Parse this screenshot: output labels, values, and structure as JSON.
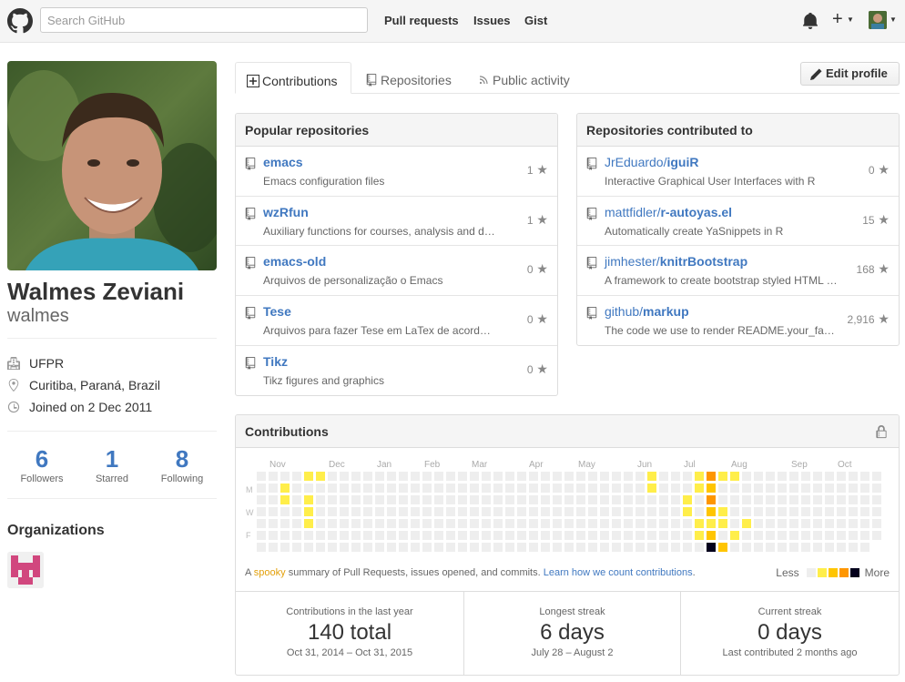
{
  "header": {
    "search_placeholder": "Search GitHub",
    "nav": [
      "Pull requests",
      "Issues",
      "Gist"
    ],
    "plus_glyph": "+"
  },
  "profile": {
    "name": "Walmes Zeviani",
    "login": "walmes",
    "organization": "UFPR",
    "location": "Curitiba, Paraná, Brazil",
    "joined": "Joined on 2 Dec 2011",
    "stats": [
      {
        "value": "6",
        "label": "Followers"
      },
      {
        "value": "1",
        "label": "Starred"
      },
      {
        "value": "8",
        "label": "Following"
      }
    ],
    "organizations_heading": "Organizations"
  },
  "tabs": [
    {
      "label": "Contributions",
      "icon": "plus-square-icon",
      "selected": true
    },
    {
      "label": "Repositories",
      "icon": "repo-icon",
      "selected": false
    },
    {
      "label": "Public activity",
      "icon": "rss-icon",
      "selected": false
    }
  ],
  "edit_profile_label": "Edit profile",
  "popular_repos": {
    "title": "Popular repositories",
    "items": [
      {
        "name": "emacs",
        "desc": "Emacs configuration files",
        "stars": "1"
      },
      {
        "name": "wzRfun",
        "desc": "Auxiliary functions for courses, analysis and d…",
        "stars": "1"
      },
      {
        "name": "emacs-old",
        "desc": "Arquivos de personalização o Emacs",
        "stars": "0"
      },
      {
        "name": "Tese",
        "desc": "Arquivos para fazer Tese em LaTex de acord…",
        "stars": "0"
      },
      {
        "name": "Tikz",
        "desc": "Tikz figures and graphics",
        "stars": "0"
      }
    ]
  },
  "contributed_repos": {
    "title": "Repositories contributed to",
    "items": [
      {
        "owner": "JrEduardo/",
        "name": "iguiR",
        "desc": "Interactive Graphical User Interfaces with R",
        "stars": "0"
      },
      {
        "owner": "mattfidler/",
        "name": "r-autoyas.el",
        "desc": "Automatically create YaSnippets in R",
        "stars": "15"
      },
      {
        "owner": "jimhester/",
        "name": "knitrBootstrap",
        "desc": "A framework to create bootstrap styled HTML …",
        "stars": "168"
      },
      {
        "owner": "github/",
        "name": "markup",
        "desc": "The code we use to render README.your_fa…",
        "stars": "2,916"
      }
    ]
  },
  "contributions": {
    "title": "Contributions",
    "months": [
      "Nov",
      "Dec",
      "Jan",
      "Feb",
      "Mar",
      "Apr",
      "May",
      "Jun",
      "Jul",
      "Aug",
      "Sep",
      "Oct"
    ],
    "day_labels": [
      "M",
      "W",
      "F"
    ],
    "note_prefix": "A ",
    "note_word": "spooky",
    "note_middle": " summary of Pull Requests, issues opened, and commits. ",
    "note_link": "Learn how we count contributions",
    "note_suffix": ".",
    "legend_less": "Less",
    "legend_more": "More",
    "legend_colors": [
      "#eeeeee",
      "#ffee4a",
      "#ffc501",
      "#fe9600",
      "#03001c"
    ],
    "stats": [
      {
        "title": "Contributions in the last year",
        "big": "140 total",
        "sub": "Oct 31, 2014 – Oct 31, 2015"
      },
      {
        "title": "Longest streak",
        "big": "6 days",
        "sub": "July 28 – August 2"
      },
      {
        "title": "Current streak",
        "big": "0 days",
        "sub": "Last contributed 2 months ago"
      }
    ],
    "active_days": [
      {
        "week": 2,
        "day": 1,
        "level": 1
      },
      {
        "week": 2,
        "day": 2,
        "level": 1
      },
      {
        "week": 4,
        "day": 0,
        "level": 1
      },
      {
        "week": 4,
        "day": 2,
        "level": 1
      },
      {
        "week": 4,
        "day": 3,
        "level": 1
      },
      {
        "week": 4,
        "day": 4,
        "level": 1
      },
      {
        "week": 5,
        "day": 0,
        "level": 1
      },
      {
        "week": 33,
        "day": 0,
        "level": 1
      },
      {
        "week": 33,
        "day": 1,
        "level": 1
      },
      {
        "week": 36,
        "day": 2,
        "level": 1
      },
      {
        "week": 36,
        "day": 3,
        "level": 1
      },
      {
        "week": 37,
        "day": 0,
        "level": 1
      },
      {
        "week": 37,
        "day": 1,
        "level": 1
      },
      {
        "week": 37,
        "day": 4,
        "level": 1
      },
      {
        "week": 37,
        "day": 5,
        "level": 1
      },
      {
        "week": 38,
        "day": 0,
        "level": 3
      },
      {
        "week": 38,
        "day": 1,
        "level": 2
      },
      {
        "week": 38,
        "day": 2,
        "level": 3
      },
      {
        "week": 38,
        "day": 3,
        "level": 2
      },
      {
        "week": 38,
        "day": 4,
        "level": 1
      },
      {
        "week": 38,
        "day": 5,
        "level": 2
      },
      {
        "week": 38,
        "day": 6,
        "level": 4
      },
      {
        "week": 39,
        "day": 0,
        "level": 1
      },
      {
        "week": 39,
        "day": 3,
        "level": 1
      },
      {
        "week": 39,
        "day": 4,
        "level": 1
      },
      {
        "week": 39,
        "day": 6,
        "level": 2
      },
      {
        "week": 40,
        "day": 0,
        "level": 1
      },
      {
        "week": 40,
        "day": 5,
        "level": 1
      },
      {
        "week": 41,
        "day": 4,
        "level": 1
      }
    ]
  }
}
